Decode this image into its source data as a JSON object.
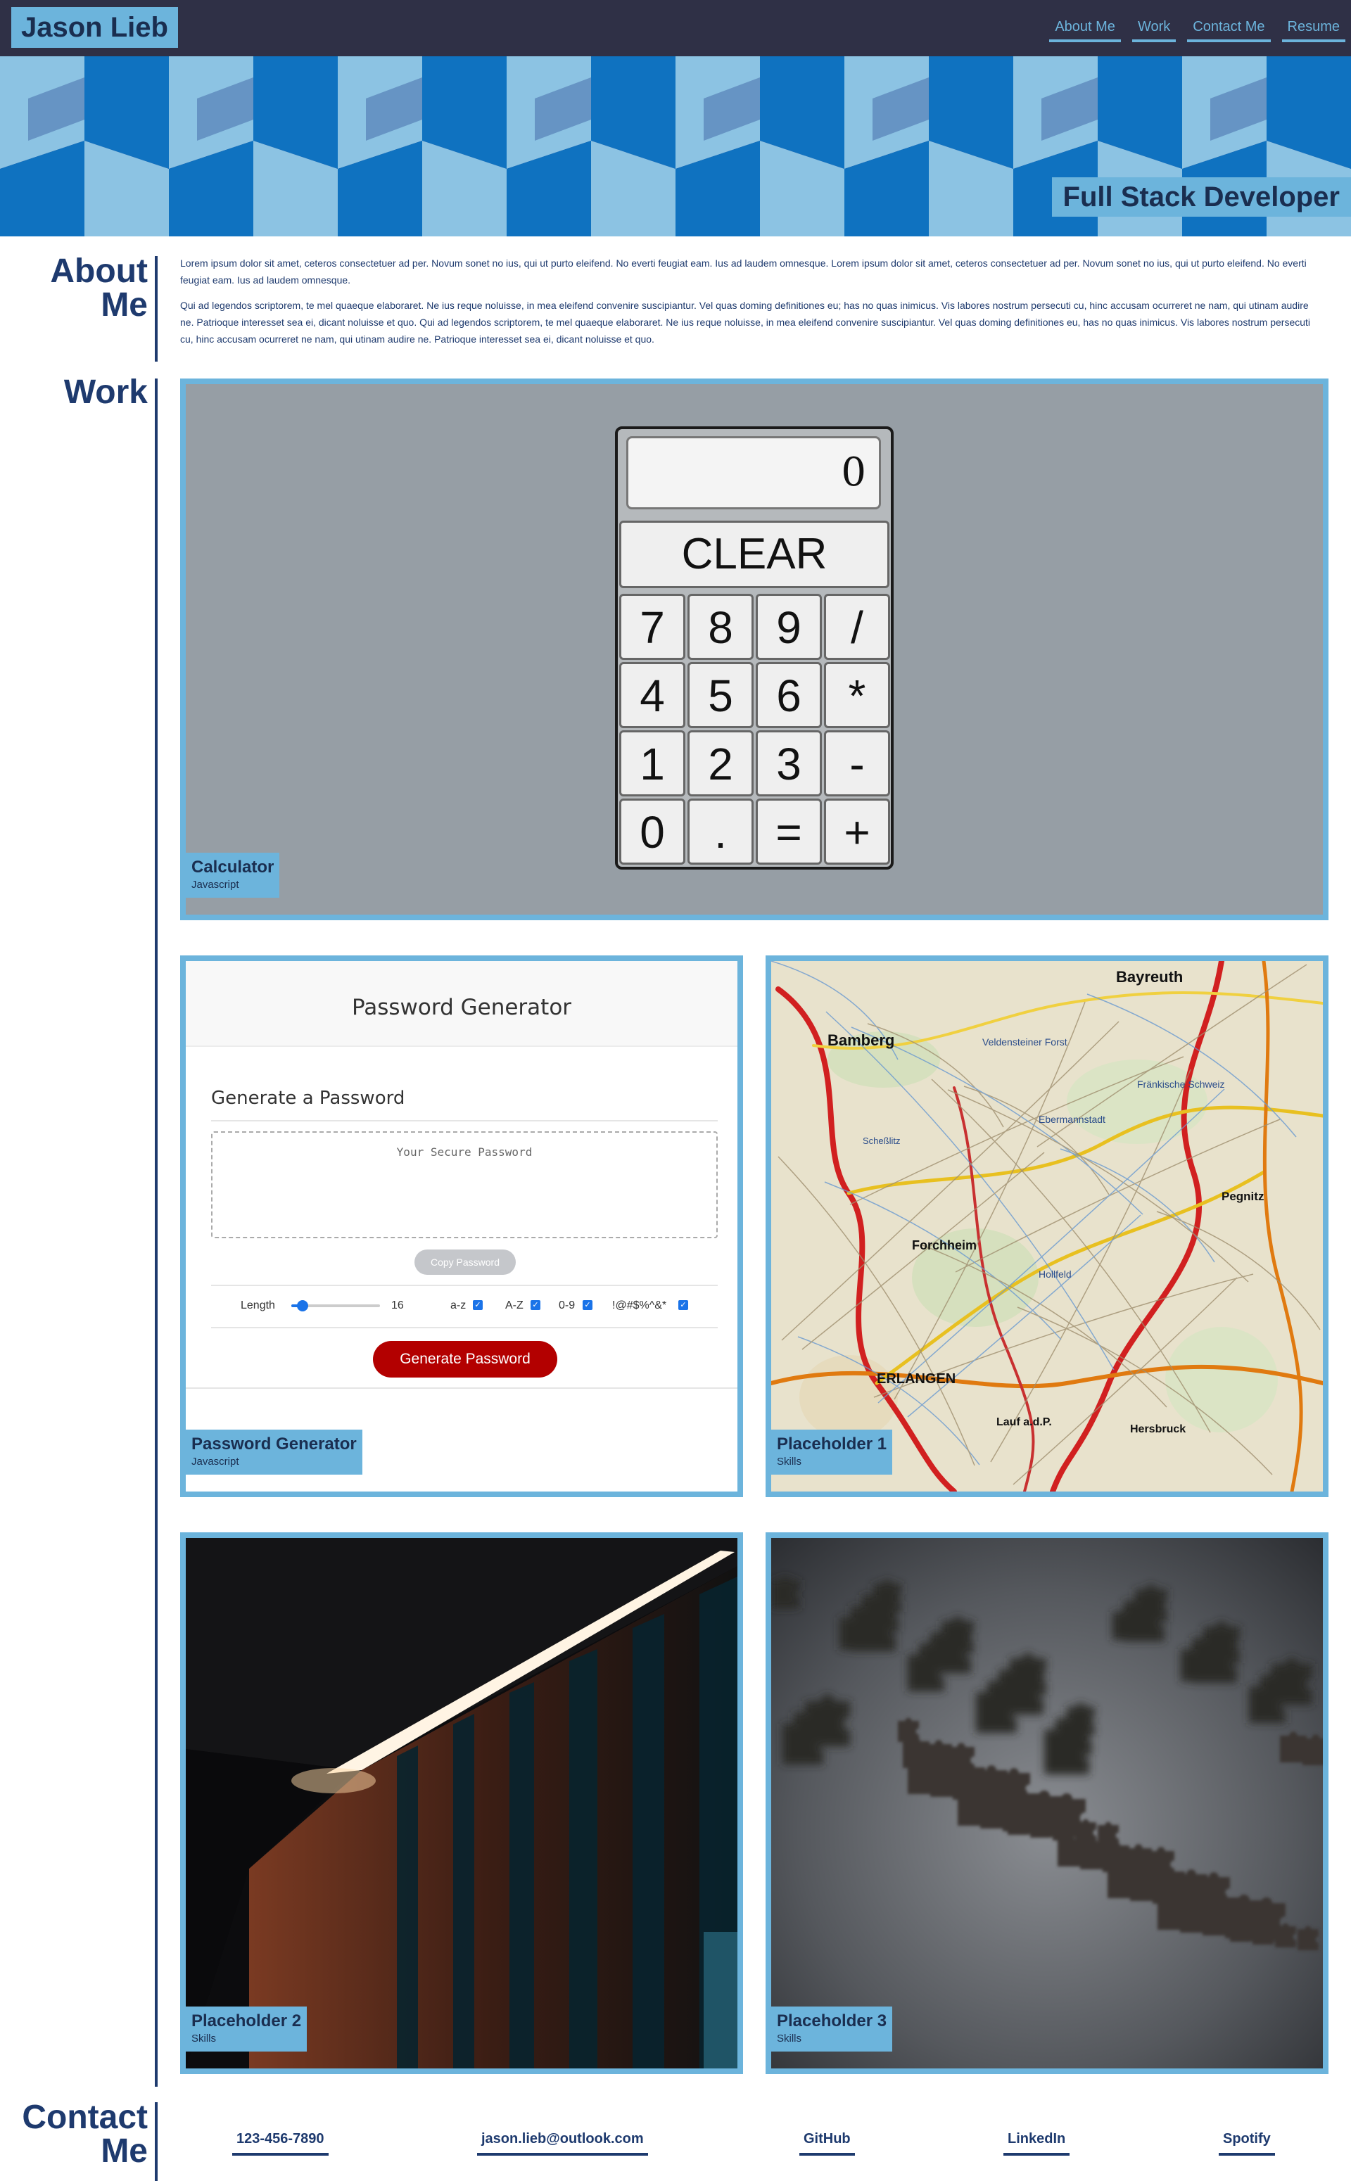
{
  "header": {
    "site_title": "Jason Lieb",
    "nav": [
      "About Me",
      "Work",
      "Contact Me",
      "Resume"
    ]
  },
  "hero": {
    "tagline": "Full Stack Developer",
    "colors": {
      "dark": "#1f3d8a",
      "mid": "#0f72c0",
      "light": "#8cc3e3",
      "wall": "#2a3a8a"
    }
  },
  "about": {
    "heading": "About Me",
    "paragraphs": [
      "Lorem ipsum dolor sit amet, ceteros consectetuer ad per. Novum sonet no ius, qui ut purto eleifend. No everti feugiat eam. Ius ad laudem omnesque. Lorem ipsum dolor sit amet, ceteros consectetuer ad per. Novum sonet no ius, qui ut purto eleifend. No everti feugiat eam. Ius ad laudem omnesque.",
      "Qui ad legendos scriptorem, te mel quaeque elaboraret. Ne ius reque noluisse, in mea eleifend convenire suscipiantur. Vel quas doming definitiones eu; has no quas inimicus. Vis labores nostrum persecuti cu, hinc accusam ocurreret ne nam, qui utinam audire ne. Patrioque interesset sea ei, dicant noluisse et quo. Qui ad legendos scriptorem, te mel quaeque elaboraret. Ne ius reque noluisse, in mea eleifend convenire suscipiantur. Vel quas doming definitiones eu, has no quas inimicus. Vis labores nostrum persecuti cu, hinc accusam ocurreret ne nam, qui utinam audire ne. Patrioque interesset sea ei, dicant noluisse et quo."
    ]
  },
  "work": {
    "heading": "Work",
    "projects": [
      {
        "name": "Calculator",
        "subtitle": "Javascript"
      },
      {
        "name": "Password Generator",
        "subtitle": "Javascript"
      },
      {
        "name": "Placeholder 1",
        "subtitle": "Skills"
      },
      {
        "name": "Placeholder 2",
        "subtitle": "Skills"
      },
      {
        "name": "Placeholder 3",
        "subtitle": "Skills"
      }
    ]
  },
  "calculator": {
    "display": "0",
    "clear_label": "CLEAR",
    "keys": [
      "7",
      "8",
      "9",
      "/",
      "4",
      "5",
      "6",
      "*",
      "1",
      "2",
      "3",
      "-",
      "0",
      ".",
      "=",
      "+"
    ]
  },
  "password_generator": {
    "title": "Password Generator",
    "subtitle": "Generate a Password",
    "placeholder": "Your Secure Password",
    "copy_label": "Copy Password",
    "length_label": "Length",
    "length_value": "16",
    "length_range": [
      8,
      128
    ],
    "options": [
      {
        "label": "a-z",
        "checked": true
      },
      {
        "label": "A-Z",
        "checked": true
      },
      {
        "label": "0-9",
        "checked": true
      },
      {
        "label": "!@#$%^&*",
        "checked": true
      }
    ],
    "generate_label": "Generate Password"
  },
  "map_labels": [
    "Bayreuth",
    "Bamberg",
    "Forchheim",
    "ERLANGEN",
    "Lauf a.d.P.",
    "Hersbruck",
    "Pegnitz",
    "Veldensteiner Forst",
    "Fränkische Schweiz",
    "Scheßlitz",
    "Hollfeld",
    "Ebermannstadt"
  ],
  "contact": {
    "heading": "Contact Me",
    "links": [
      "123-456-7890",
      "jason.lieb@outlook.com",
      "GitHub",
      "LinkedIn",
      "Spotify"
    ]
  }
}
